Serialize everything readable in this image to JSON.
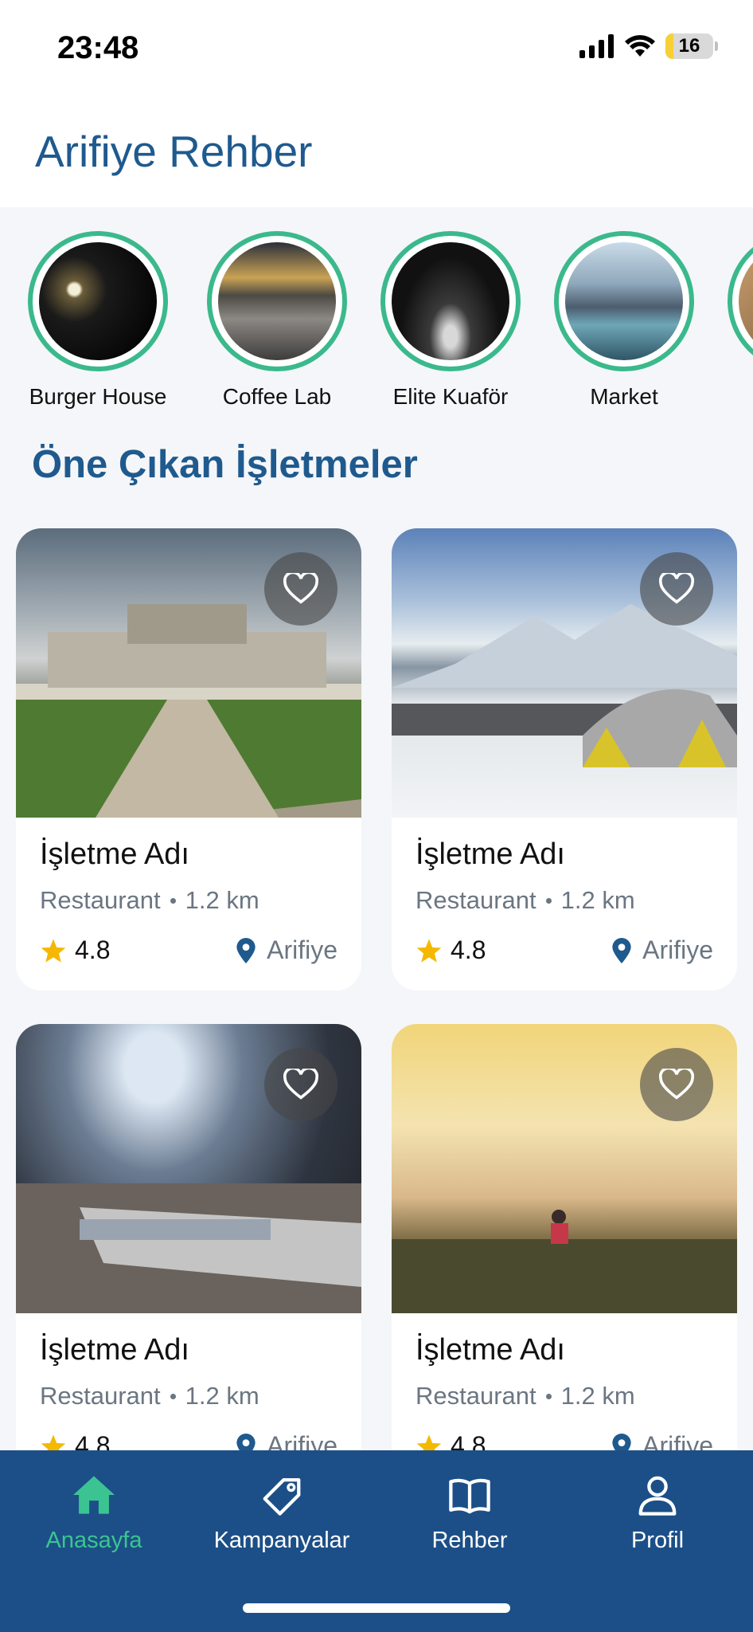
{
  "status_bar": {
    "time": "23:48",
    "battery": "16",
    "battery_level": 0.16
  },
  "header": {
    "title": "Arifiye Rehber"
  },
  "stories": [
    {
      "label": "Burger House"
    },
    {
      "label": "Coffee Lab"
    },
    {
      "label": "Elite Kuaför"
    },
    {
      "label": "Market"
    }
  ],
  "section_title": "Öne Çıkan İşletmeler",
  "cards": [
    {
      "name": "İşletme Adı",
      "category": "Restaurant",
      "distance": "1.2 km",
      "rating": "4.8",
      "location": "Arifiye"
    },
    {
      "name": "İşletme Adı",
      "category": "Restaurant",
      "distance": "1.2 km",
      "rating": "4.8",
      "location": "Arifiye"
    },
    {
      "name": "İşletme Adı",
      "category": "Restaurant",
      "distance": "1.2 km",
      "rating": "4.8",
      "location": "Arifiye"
    },
    {
      "name": "İşletme Adı",
      "category": "Restaurant",
      "distance": "1.2 km",
      "rating": "4.8",
      "location": "Arifiye"
    }
  ],
  "nav": [
    {
      "label": "Anasayfa",
      "icon": "home-icon",
      "active": true
    },
    {
      "label": "Kampanyalar",
      "icon": "tag-icon"
    },
    {
      "label": "Rehber",
      "icon": "book-icon"
    },
    {
      "label": "Profil",
      "icon": "user-icon"
    }
  ],
  "colors": {
    "primary": "#1f5a8e",
    "accent": "#3bb98c",
    "nav_bg": "#1c4f87",
    "star": "#f5b800"
  }
}
